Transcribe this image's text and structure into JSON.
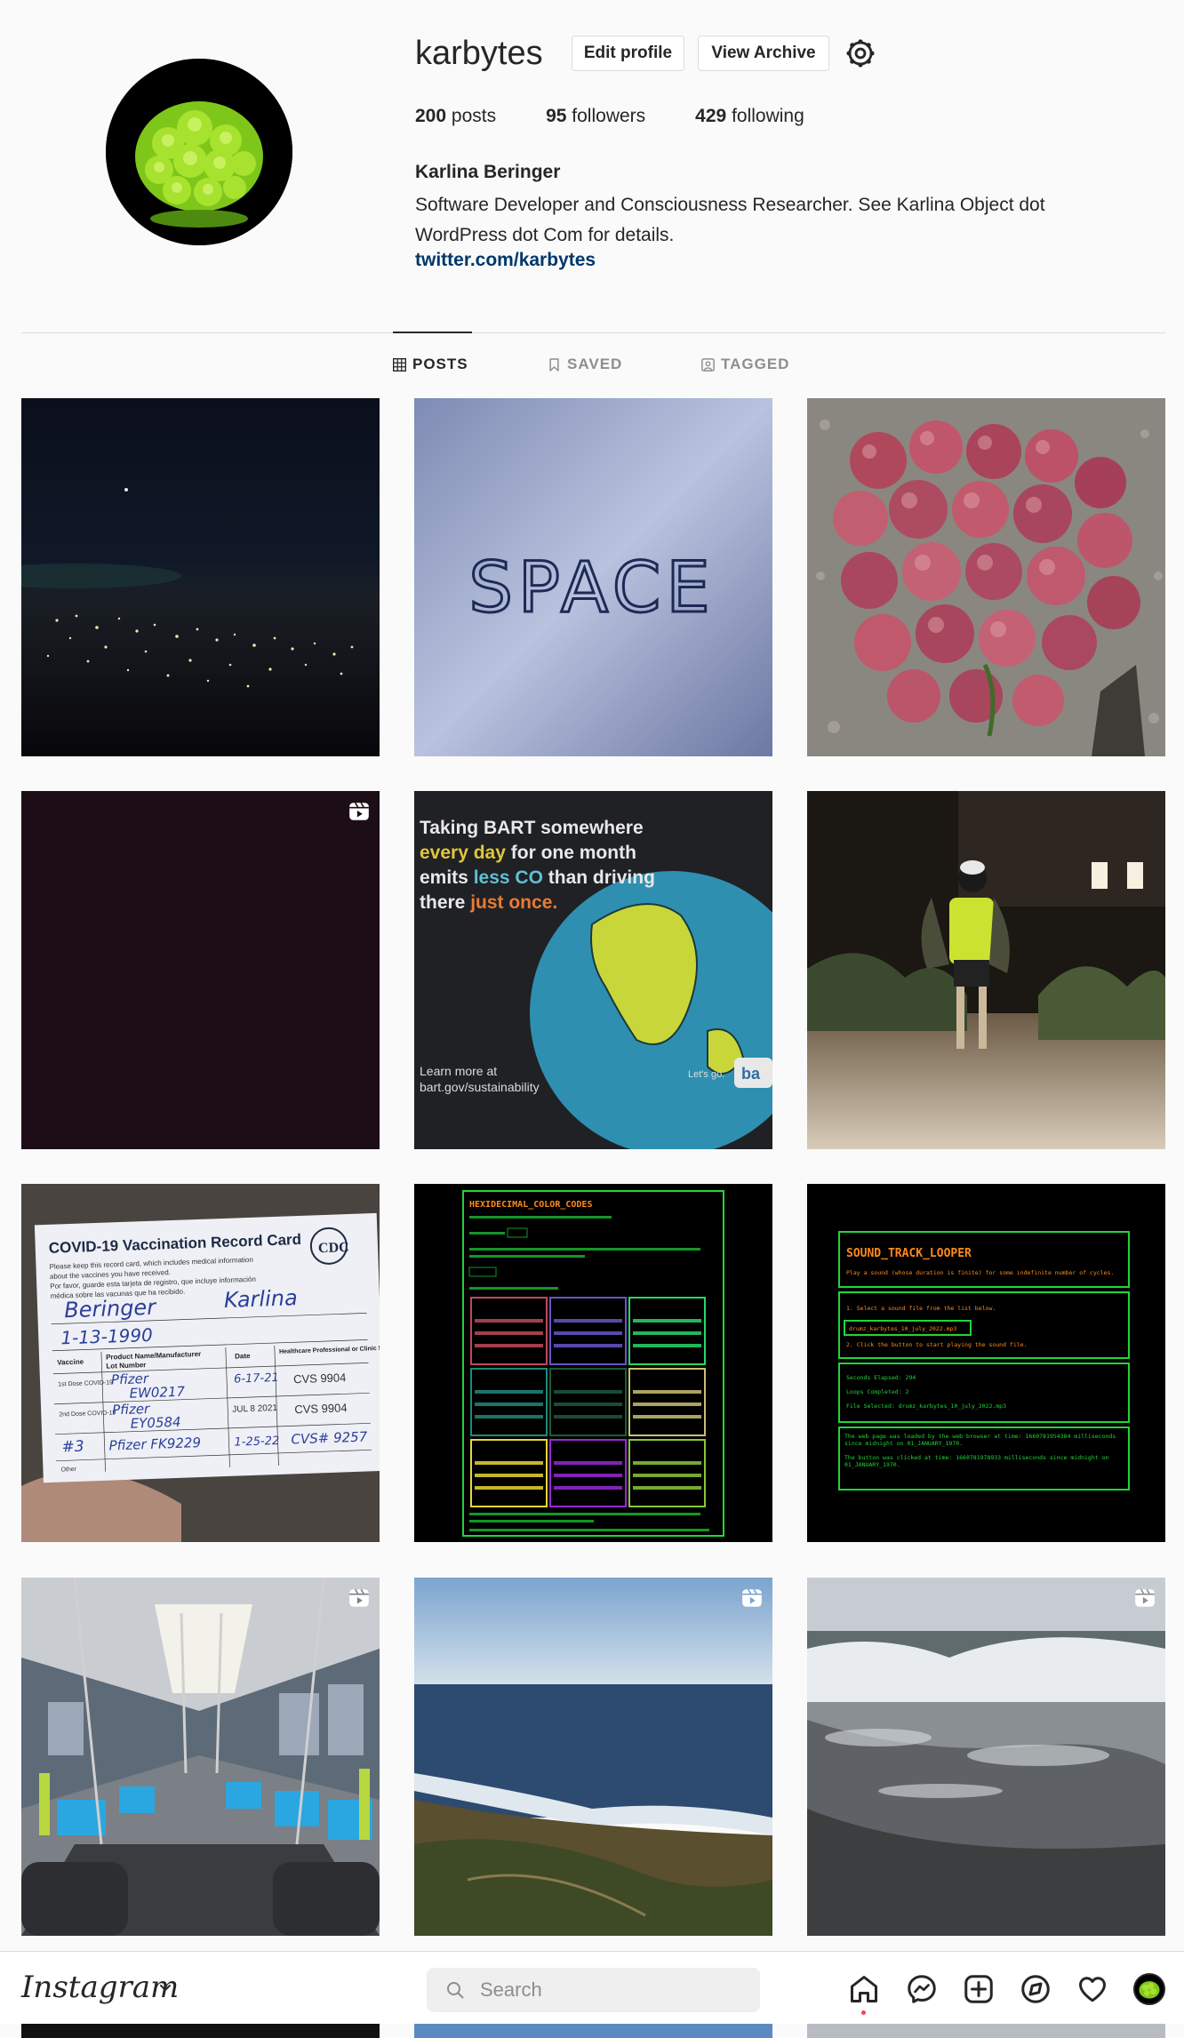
{
  "profile": {
    "username": "karbytes",
    "edit_label": "Edit profile",
    "archive_label": "View Archive",
    "posts_count": "200",
    "posts_label": "posts",
    "followers_count": "95",
    "followers_label": "followers",
    "following_count": "429",
    "following_label": "following",
    "full_name": "Karlina Beringer",
    "bio": "Software Developer and Consciousness Researcher. See Karlina Object dot WordPress dot Com for details.",
    "link": "twitter.com/karbytes"
  },
  "tabs": [
    {
      "label": "POSTS",
      "icon": "grid-icon",
      "active": true
    },
    {
      "label": "SAVED",
      "icon": "bookmark-icon",
      "active": false
    },
    {
      "label": "TAGGED",
      "icon": "tag-icon",
      "active": false
    }
  ],
  "grid": {
    "posts": [
      {
        "subject": "night city lights",
        "reel": false
      },
      {
        "subject": "SPACE handwritten",
        "reel": false
      },
      {
        "subject": "pile of apples",
        "reel": false
      },
      {
        "subject": "dark frame",
        "reel": true
      },
      {
        "subject": "BART poster",
        "reel": false
      },
      {
        "subject": "person at night",
        "reel": false
      },
      {
        "subject": "vaccination card",
        "reel": false
      },
      {
        "subject": "hex color codes app",
        "reel": false
      },
      {
        "subject": "sound track looper app",
        "reel": false
      },
      {
        "subject": "train interior",
        "reel": true
      },
      {
        "subject": "coastline",
        "reel": true
      },
      {
        "subject": "ocean waves",
        "reel": true
      }
    ],
    "bart_poster": {
      "line1": "Taking BART somewhere",
      "line2a": "every day",
      "line2b": " for one month",
      "line3a": "emits ",
      "line3b": "less CO",
      "line3c": " than driving",
      "line4a": "there ",
      "line4b": "just once.",
      "foot1": "Learn more at",
      "foot2": "bart.gov/sustainability",
      "tagline": "Let's go."
    },
    "space_word": "SPACE",
    "vax_card": {
      "title": "COVID-19 Vaccination Record Card",
      "sub1": "Please keep this record card, which includes medical information",
      "sub2": "about the vaccines you have received.",
      "sub3": "Por favor, guarde esta tarjeta de registro, que incluye información",
      "sub4": "médica sobre las vacunas que ha recibido.",
      "last": "Beringer",
      "first": "Karlina",
      "dob": "1-13-1990",
      "cdc": "CDC",
      "col_vaccine": "Vaccine",
      "col_product": "Product Name/Manufacturer",
      "col_lot": "Lot Number",
      "col_date": "Date",
      "col_site": "Healthcare Professional or Clinic Site",
      "dose1_label": "1st Dose COVID-19",
      "dose1_product": "Pfizer",
      "dose1_lot": "EW0217",
      "dose1_date": "6-17-21",
      "dose1_site": "CVS 9904",
      "dose2_label": "2nd Dose COVID-19",
      "dose2_product": "Pfizer",
      "dose2_lot": "EY0584",
      "dose2_date": "JUL 8 2021",
      "dose2_site": "CVS 9904",
      "dose3_label": "#3",
      "dose3_product": "Pfizer FK9229",
      "dose3_date": "1-25-22",
      "dose3_site": "CVS# 9257",
      "other": "Other"
    },
    "hex_app": {
      "title": "HEXIDECIMAL_COLOR_CODES"
    },
    "looper_app": {
      "title": "SOUND_TRACK_LOOPER",
      "subtitle": "Play a sound (whose duration is finite) for some indefinite number of cycles.",
      "step1": "1. Select a sound file from the list below.",
      "file": "drumz_karbytes_10_july_2022.mp3",
      "step2": "2. Click the button to start playing the sound file.",
      "elapsed": "Seconds Elapsed: 294",
      "loops": "Loops Completed: 2",
      "selected": "File Selected: drumz_karbytes_10_july_2022.mp3",
      "loaded": "The web page was loaded by the web browser at time: 1660781954384 milliseconds since midnight on 01_JANUARY_1970.",
      "clicked": "The button was clicked at time: 1660781978933 milliseconds since midnight on 01_JANUARY_1970."
    }
  },
  "bottom_bar": {
    "logo": "Instagram",
    "search_placeholder": "Search"
  },
  "colors": {
    "link": "#00376b",
    "background": "#fafafa",
    "notification_dot": "#ed4956"
  }
}
